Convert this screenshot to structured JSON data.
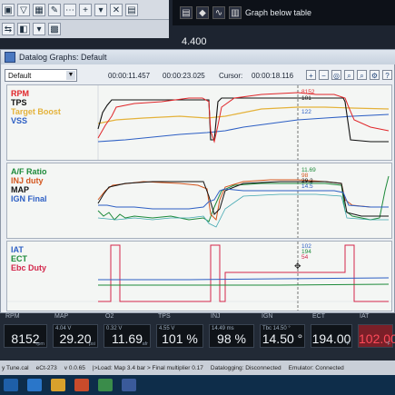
{
  "toolbar_right": {
    "graph_below_label": "Graph below table",
    "value_display": "4.400"
  },
  "window": {
    "title": "Datalog Graphs: Default"
  },
  "controls": {
    "layout_select": "Default",
    "time_start": "00:00:11.457",
    "time_end": "00:00:23.025",
    "cursor_label": "Cursor:",
    "cursor_time": "00:00:18.116"
  },
  "pane1": {
    "labels": [
      {
        "name": "RPM",
        "color": "#e0262a"
      },
      {
        "name": "TPS",
        "color": "#111111"
      },
      {
        "name": "Target Boost",
        "color": "#e4b23a"
      },
      {
        "name": "VSS",
        "color": "#2d5fc4"
      }
    ],
    "cursor_values": [
      {
        "text": "8152",
        "color": "#e0262a"
      },
      {
        "text": "101",
        "color": "#111111"
      },
      {
        "text": "122",
        "color": "#2d5fc4"
      }
    ]
  },
  "pane2": {
    "labels": [
      {
        "name": "A/F Ratio",
        "color": "#1d8a3a"
      },
      {
        "name": "INJ duty",
        "color": "#d3561e"
      },
      {
        "name": "MAP",
        "color": "#111111"
      },
      {
        "name": "IGN Final",
        "color": "#2d5fc4"
      }
    ],
    "cursor_values": [
      {
        "text": "11.69",
        "color": "#1d8a3a"
      },
      {
        "text": "98",
        "color": "#d3561e"
      },
      {
        "text": "29.2",
        "color": "#111111"
      },
      {
        "text": "14.5",
        "color": "#2d5fc4"
      }
    ]
  },
  "pane3": {
    "labels": [
      {
        "name": "IAT",
        "color": "#2d5fc4"
      },
      {
        "name": "ECT",
        "color": "#1d8a3a"
      },
      {
        "name": "Ebc Duty",
        "color": "#d3264a"
      }
    ],
    "cursor_values": [
      {
        "text": "102",
        "color": "#2d5fc4"
      },
      {
        "text": "194",
        "color": "#1d8a3a"
      },
      {
        "text": "54",
        "color": "#d3264a"
      }
    ]
  },
  "gauges": [
    {
      "label": "RPM",
      "value": "8152",
      "unit": "rpm",
      "sub": ""
    },
    {
      "label": "MAP",
      "value": "29.20",
      "unit": "psi",
      "sub": "4.04 V"
    },
    {
      "label": "O2",
      "value": "11.69",
      "unit": "afr",
      "sub": "0.32 V"
    },
    {
      "label": "TPS",
      "value": "101 %",
      "unit": "",
      "sub": "4.55 V"
    },
    {
      "label": "INJ",
      "value": "98 %",
      "unit": "",
      "sub": "14.49 ms"
    },
    {
      "label": "IGN",
      "value": "14.50 °",
      "unit": "",
      "sub": "Tbc 14.50 °"
    },
    {
      "label": "ECT",
      "value": "194.00",
      "unit": "°F",
      "sub": ""
    },
    {
      "label": "IAT",
      "value": "102.00",
      "unit": "°F",
      "sub": ""
    }
  ],
  "status": {
    "file": "y Tune.cal",
    "ect": "eCt-273",
    "version": "v 0.0.65",
    "load": "|>Load: Map 3.4 bar > Final multiplier 0.17",
    "datalogging": "Datalogging: Disconnected",
    "emulator": "Emulator: Connected"
  },
  "colors": {
    "accent": "#2d5fc4",
    "rpm": "#e0262a"
  }
}
